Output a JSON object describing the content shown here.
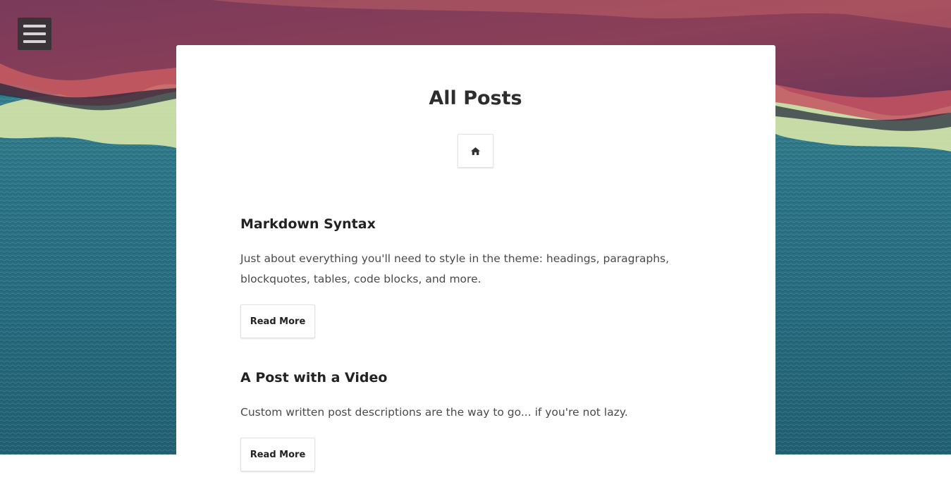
{
  "header": {
    "menu_icon": "hamburger-menu-icon"
  },
  "main": {
    "title": "All Posts",
    "home_icon": "home-icon"
  },
  "posts": [
    {
      "title": "Markdown Syntax",
      "excerpt": "Just about everything you'll need to style in the theme: headings, paragraphs, blockquotes, tables, code blocks, and more.",
      "read_more_label": "Read More"
    },
    {
      "title": "A Post with a Video",
      "excerpt": "Custom written post descriptions are the way to go... if you're not lazy.",
      "read_more_label": "Read More"
    }
  ],
  "colors": {
    "card": "#ffffff",
    "title_text": "#2d2d2d",
    "body_text": "#4a4a4a",
    "menu_bg": "#3a3338"
  }
}
